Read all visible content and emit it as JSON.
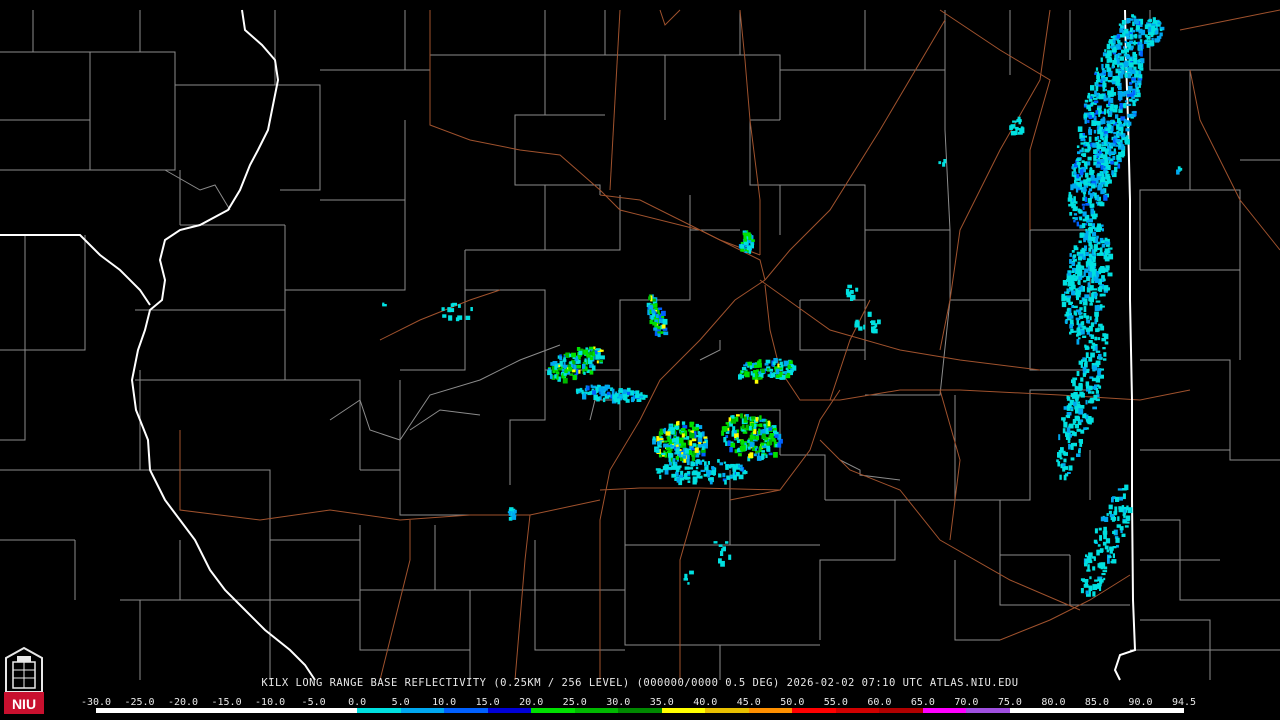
{
  "product": {
    "title": "KILX LONG RANGE BASE REFLECTIVITY (0.25KM / 256 LEVEL) (000000/0000 0.5 DEG) 2026-02-02 07:10 UTC  ATLAS.NIU.EDU"
  },
  "logo": {
    "text": "NIU"
  },
  "scale": {
    "labels": [
      "-30.0",
      "-25.0",
      "-20.0",
      "-15.0",
      "-10.0",
      "-5.0",
      "0.0",
      "5.0",
      "10.0",
      "15.0",
      "20.0",
      "25.0",
      "30.0",
      "35.0",
      "40.0",
      "45.0",
      "50.0",
      "55.0",
      "60.0",
      "65.0",
      "70.0",
      "75.0",
      "80.0",
      "85.0",
      "90.0",
      "94.5"
    ],
    "colors": [
      "#ffffff",
      "#ffffff",
      "#ffffff",
      "#ffffff",
      "#ffffff",
      "#ffffff",
      "#00e0e0",
      "#00a8f0",
      "#0060ff",
      "#0000d8",
      "#00e000",
      "#00b800",
      "#008800",
      "#ffff00",
      "#e8c000",
      "#ff9000",
      "#ff0000",
      "#d00000",
      "#b00000",
      "#ff00ff",
      "#a050e0",
      "#ffffff",
      "#ffffff",
      "#ffffff",
      "#ffffff"
    ]
  },
  "colors": {
    "county_lines": "#8c8c8c",
    "state_lines": "#ffffff",
    "highways": "#a0522d",
    "background": "#000000"
  }
}
